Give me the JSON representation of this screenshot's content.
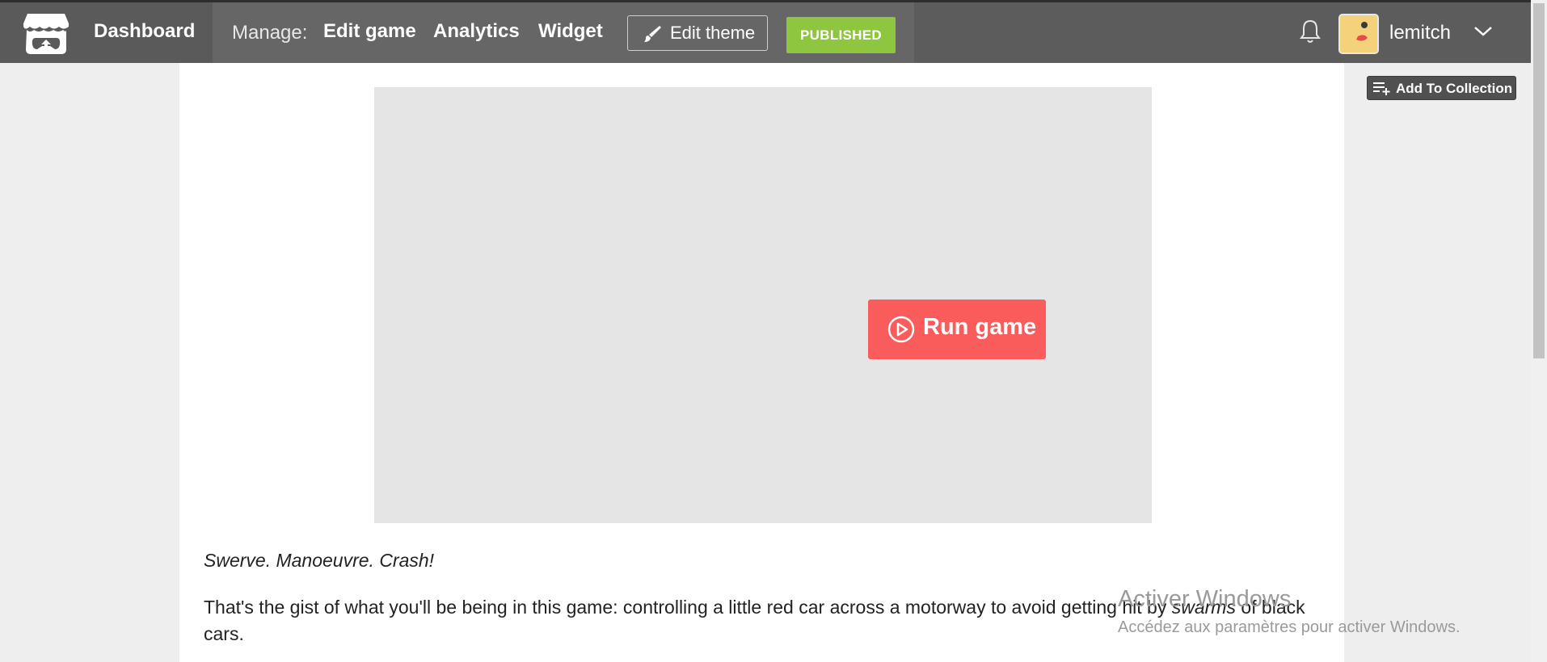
{
  "topbar": {
    "dashboard": "Dashboard",
    "manage_label": "Manage:",
    "edit_game": "Edit game",
    "analytics": "Analytics",
    "widget": "Widget",
    "edit_theme": "Edit theme",
    "status": "PUBLISHED",
    "username": "lemitch"
  },
  "actions": {
    "add_to_collection": "Add To Collection"
  },
  "game": {
    "run_label": "Run game"
  },
  "description": {
    "tagline": "Swerve. Manoeuvre. Crash!",
    "paragraph_before": "That's the gist of what you'll be being in this game: controlling a little red car across a motorway to avoid getting hit by ",
    "emphasis": "swarms",
    "paragraph_after": " of black cars."
  },
  "watermark": {
    "title": "Activer Windows",
    "subtitle": "Accédez aux paramètres pour activer Windows."
  },
  "colors": {
    "topbar": "#5c5c5c",
    "published": "#8ec63f",
    "run_button": "#fa5c5c"
  }
}
